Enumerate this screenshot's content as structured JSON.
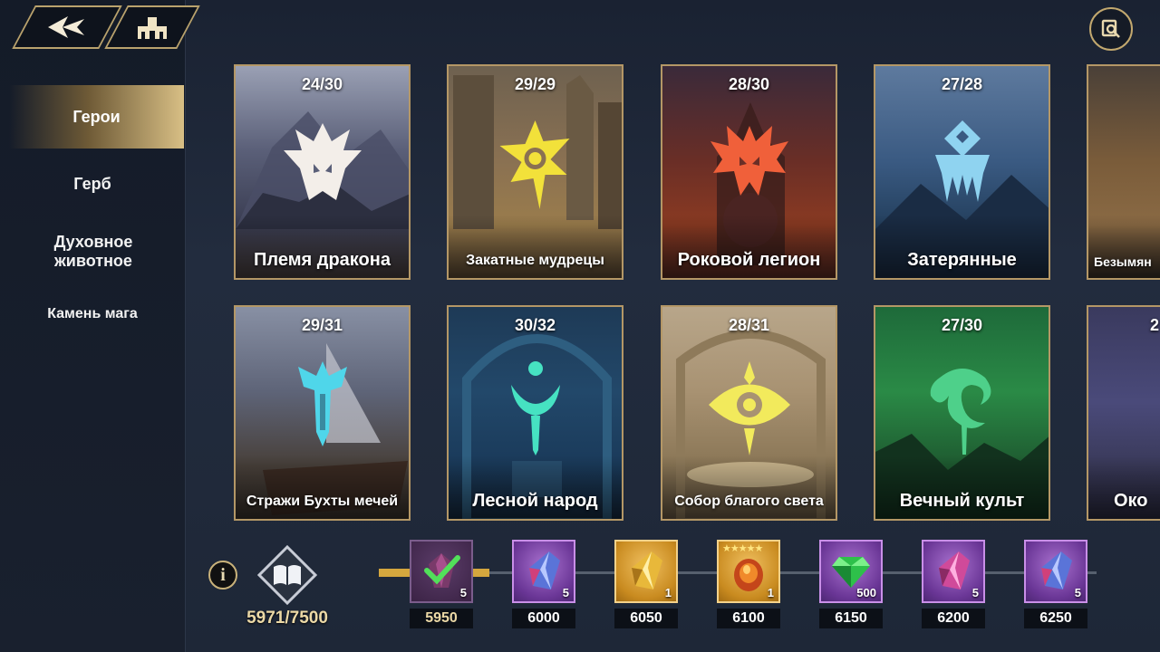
{
  "nav": {
    "items": [
      {
        "label": "Герои",
        "active": true
      },
      {
        "label": "Герб",
        "active": false
      },
      {
        "label": "Духовное животное",
        "active": false
      },
      {
        "label": "Камень мага",
        "active": false
      }
    ]
  },
  "factions": [
    {
      "count": "24/30",
      "name": "Племя дракона",
      "icon": "dragon-tribe-emblem",
      "color": "#f3eee9"
    },
    {
      "count": "29/29",
      "name": "Закатные мудрецы",
      "icon": "sunset-sages-emblem",
      "color": "#f2e13a"
    },
    {
      "count": "28/30",
      "name": "Роковой легион",
      "icon": "doom-legion-emblem",
      "color": "#f0603a"
    },
    {
      "count": "27/28",
      "name": "Затерянные",
      "icon": "lost-emblem",
      "color": "#8fd3f0"
    },
    {
      "count": "",
      "name": "Безымян",
      "icon": "nameless-emblem",
      "color": "#e8c890"
    },
    {
      "count": "29/31",
      "name": "Стражи Бухты мечей",
      "icon": "sword-cove-guardians-emblem",
      "color": "#4fd6ea"
    },
    {
      "count": "30/32",
      "name": "Лесной народ",
      "icon": "forest-folk-emblem",
      "color": "#46e2c2"
    },
    {
      "count": "28/31",
      "name": "Собор благого света",
      "icon": "holy-light-cathedral-emblem",
      "color": "#f2ea5c"
    },
    {
      "count": "27/30",
      "name": "Вечный культ",
      "icon": "eternal-cult-emblem",
      "color": "#4ed08a"
    },
    {
      "count": "2",
      "name": "Око",
      "icon": "eye-emblem",
      "color": "#d8a0ff"
    }
  ],
  "progress": {
    "value": "5971/7500",
    "fraction": 0.7961
  },
  "rewards": [
    {
      "threshold": "5950",
      "qty": "5",
      "item": "dark-crystal-icon",
      "rarity": "purple",
      "claimed": true
    },
    {
      "threshold": "6000",
      "qty": "5",
      "item": "blue-crystal-icon",
      "rarity": "purple",
      "claimed": false
    },
    {
      "threshold": "6050",
      "qty": "1",
      "item": "gold-crystal-icon",
      "rarity": "gold",
      "claimed": false
    },
    {
      "threshold": "6100",
      "qty": "1",
      "item": "fire-egg-icon",
      "rarity": "gold",
      "claimed": false,
      "stars": 5
    },
    {
      "threshold": "6150",
      "qty": "500",
      "item": "emerald-icon",
      "rarity": "purple",
      "claimed": false
    },
    {
      "threshold": "6200",
      "qty": "5",
      "item": "pink-crystal-icon",
      "rarity": "purple",
      "claimed": false
    },
    {
      "threshold": "6250",
      "qty": "5",
      "item": "blue-crystal-icon",
      "rarity": "purple",
      "claimed": false
    }
  ]
}
